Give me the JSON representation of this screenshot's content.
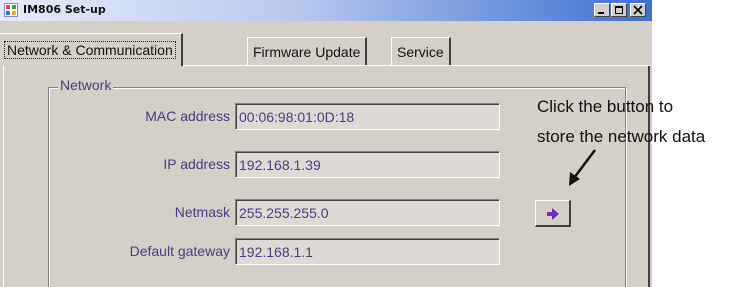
{
  "window": {
    "title": "IM806 Set-up"
  },
  "tabs": [
    {
      "label": "Network & Communication",
      "active": true
    },
    {
      "label": "Firmware Update",
      "active": false
    },
    {
      "label": "Service",
      "active": false
    }
  ],
  "network": {
    "group_label": "Network",
    "fields": [
      {
        "label": "MAC address",
        "value": "00:06:98:01:0D:18"
      },
      {
        "label": "IP address",
        "value": "192.168.1.39"
      },
      {
        "label": "Netmask",
        "value": "255.255.255.0"
      },
      {
        "label": "Default gateway",
        "value": "192.168.1.1"
      }
    ]
  },
  "store_button": {
    "icon": "right-arrow-icon",
    "color": "#6a2fb0"
  },
  "annotation": {
    "line1": "Click the button to",
    "line2": "store the network data"
  },
  "colors": {
    "label_text": "#4b3a86",
    "window_face": "#d4d0c8",
    "titlebar_end": "#3d6fd0"
  }
}
